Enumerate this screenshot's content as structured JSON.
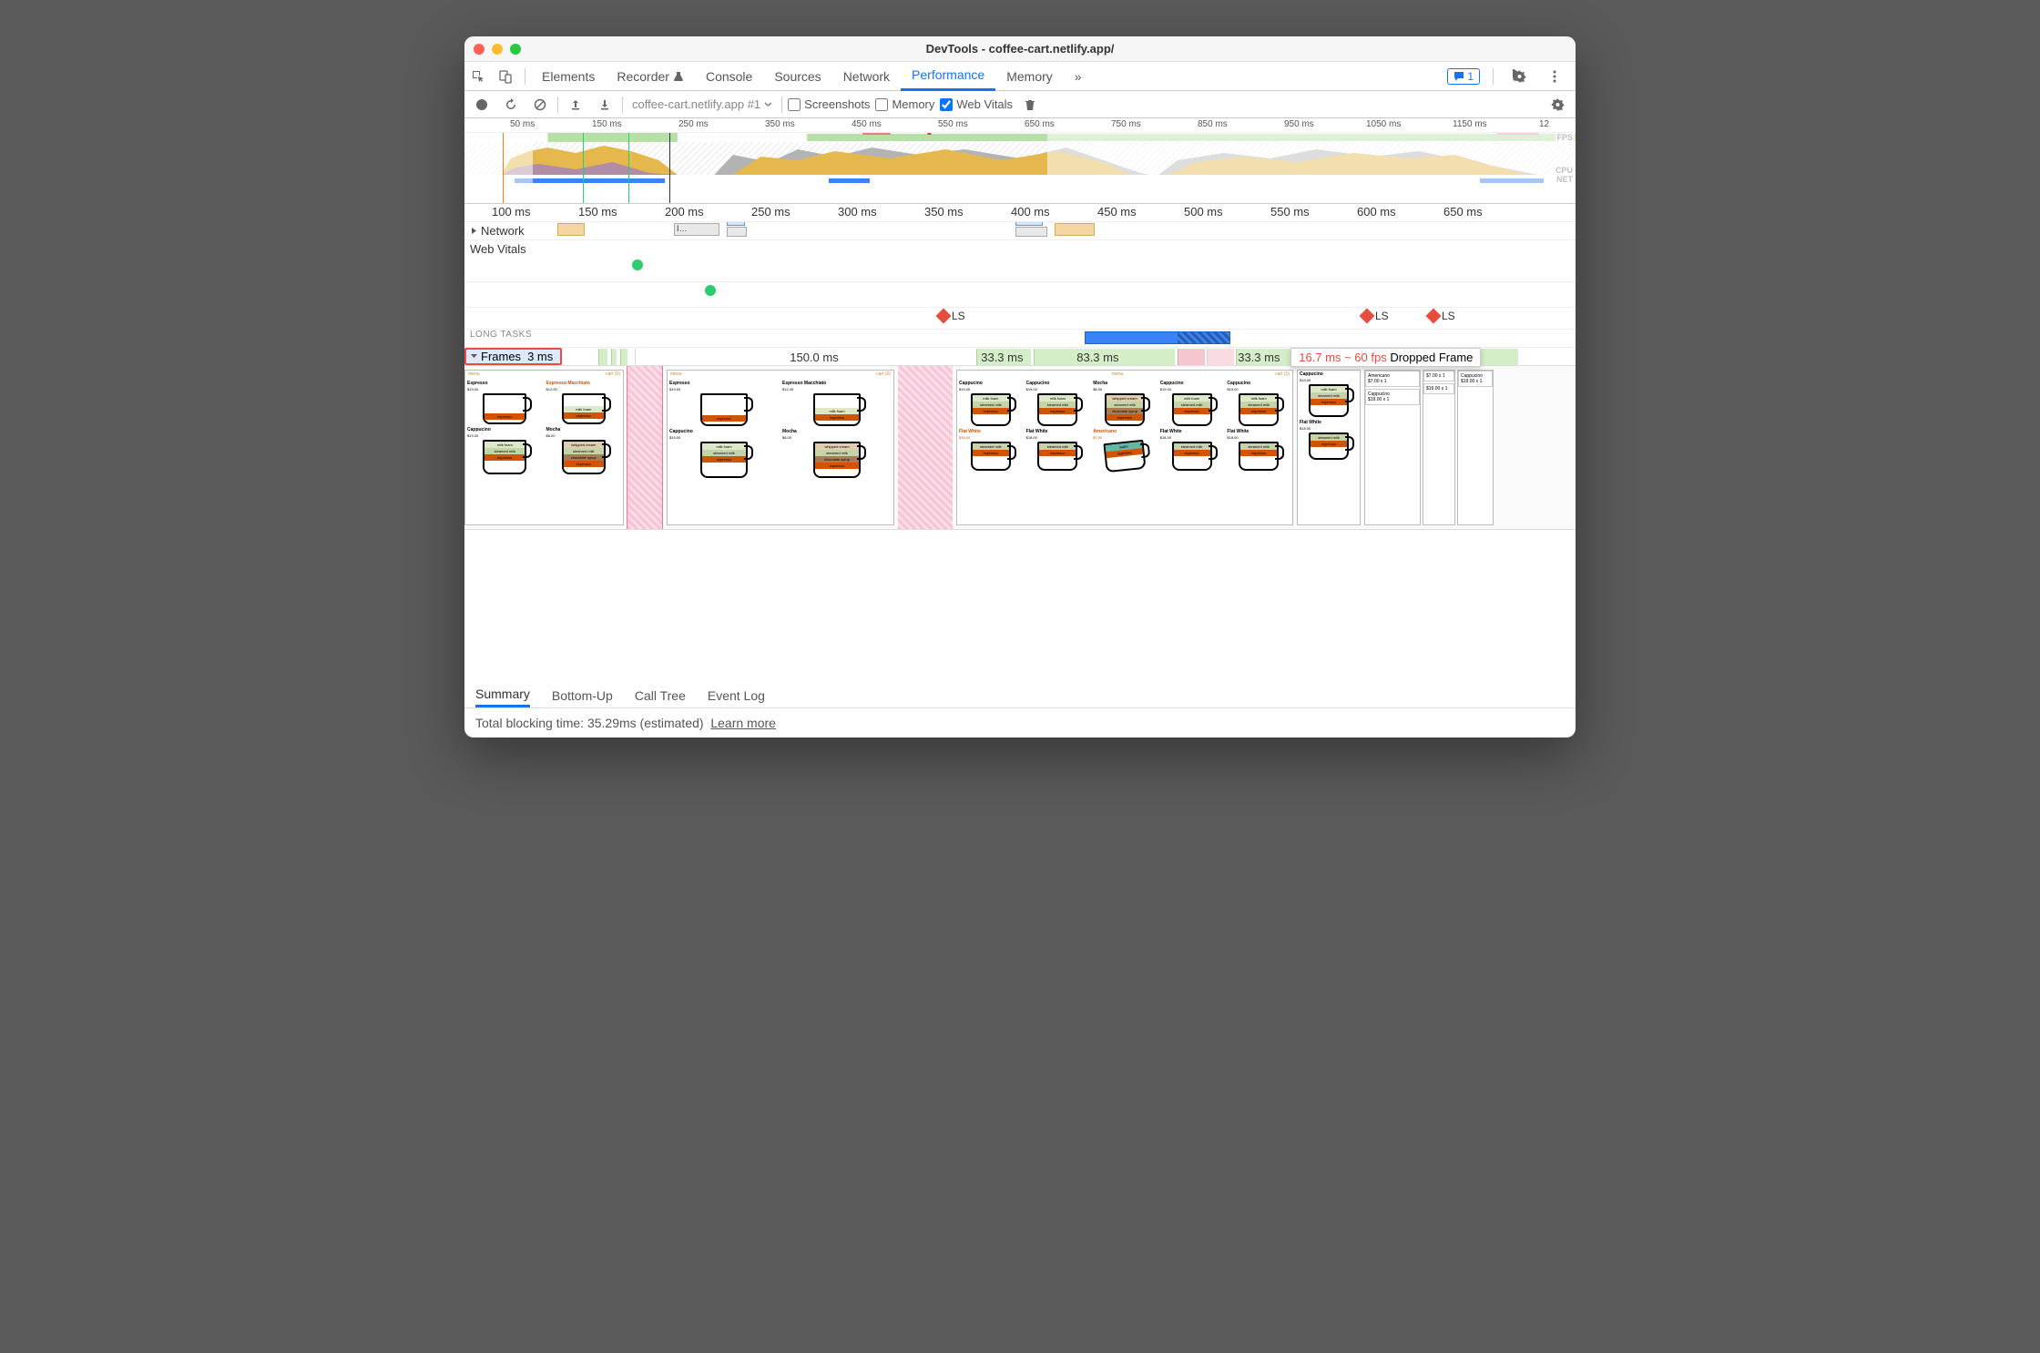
{
  "title": "DevTools - coffee-cart.netlify.app/",
  "panels": [
    "Elements",
    "Recorder",
    "Console",
    "Sources",
    "Network",
    "Performance",
    "Memory"
  ],
  "activePanel": "Performance",
  "moreIcon": "»",
  "issuesCount": "1",
  "toolbar": {
    "recordingName": "coffee-cart.netlify.app #1",
    "checkboxes": {
      "screenshots": "Screenshots",
      "memory": "Memory",
      "webVitals": "Web Vitals"
    },
    "webVitalsChecked": true
  },
  "overview": {
    "ticks": [
      "50 ms",
      "150 ms",
      "250 ms",
      "350 ms",
      "450 ms",
      "550 ms",
      "650 ms",
      "750 ms",
      "850 ms",
      "950 ms",
      "1050 ms",
      "1150 ms",
      "12"
    ],
    "labels": {
      "fps": "FPS",
      "cpu": "CPU",
      "net": "NET"
    }
  },
  "ruler2": [
    "100 ms",
    "150 ms",
    "200 ms",
    "250 ms",
    "300 ms",
    "350 ms",
    "400 ms",
    "450 ms",
    "500 ms",
    "550 ms",
    "600 ms",
    "650 ms"
  ],
  "tracks": {
    "network": "Network",
    "networkItem": "I…",
    "webVitals": "Web Vitals",
    "ls": "LS",
    "longTasks": "LONG TASKS",
    "frames": "Frames",
    "frameTimes": [
      "3 ms",
      "150.0 ms",
      "33.3 ms",
      "83.3 ms",
      "33.3 ms"
    ],
    "tooltip": {
      "rate": "16.7 ms ~ 60 fps",
      "status": "Dropped Frame"
    }
  },
  "coffees": {
    "menu": "menu",
    "cart0": "cart (0)",
    "cart1": "cart (1)",
    "espresso": {
      "name": "Espresso",
      "price": "$19.00"
    },
    "macchiato": {
      "name": "Espresso Macchiato",
      "price": "$12.00"
    },
    "cappuccino": {
      "name": "Cappucino",
      "price": "$19.00"
    },
    "mocha": {
      "name": "Mocha",
      "price": "$8.00"
    },
    "flatwhite": {
      "name": "Flat White",
      "price": "$18.00"
    },
    "americano": {
      "name": "Americano",
      "price": "$7.00"
    },
    "layers": {
      "espresso": "espresso",
      "milkfoam": "milk foam",
      "steamed": "steamed milk",
      "whipped": "whipped cream",
      "syrup": "chocolate syrup",
      "water": "water"
    },
    "cart": {
      "line1": "Americano",
      "line1p": "$7.00 x 1",
      "line2": "Cappucino",
      "line2p": "$19.00 x 1"
    }
  },
  "details": {
    "tabs": [
      "Summary",
      "Bottom-Up",
      "Call Tree",
      "Event Log"
    ],
    "activeTab": "Summary",
    "tbtLabel": "Total blocking time:",
    "tbtValue": "35.29ms (estimated)",
    "learnMore": "Learn more"
  }
}
